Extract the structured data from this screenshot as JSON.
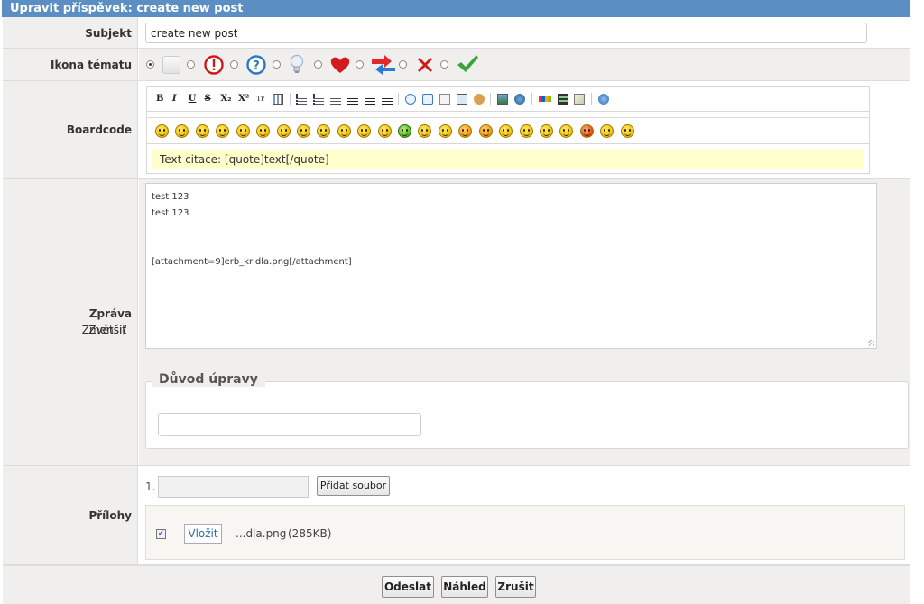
{
  "header": {
    "title": "Upravit příspěvek: create new post"
  },
  "subject": {
    "label": "Subjekt",
    "value": "create new post"
  },
  "topic_icon": {
    "label": "Ikona tématu",
    "options": [
      "none-icon",
      "blank-icon",
      "exclamation-icon",
      "question-icon",
      "lightbulb-icon",
      "heart-icon",
      "arrows-icon",
      "red-x-icon",
      "green-check-icon"
    ],
    "selected_index": 0
  },
  "boardcode": {
    "label": "Boardcode",
    "toolbar": [
      "B",
      "I",
      "U",
      "S",
      "X₂",
      "X²",
      "Tr"
    ],
    "smilies_count": 24,
    "hint": "Text citace: [quote]text[/quote]"
  },
  "message": {
    "label": "Zpráva",
    "enlarge": "Zvětšit",
    "separator": " / ",
    "shrink": "Zmenšit",
    "lines": [
      "test 123",
      "test 123",
      "",
      "",
      "[attachment=9]erb_kridla.png[/attachment]"
    ]
  },
  "edit_reason": {
    "legend": "Důvod úpravy",
    "value": ""
  },
  "attachments": {
    "label": "Přílohy",
    "index": "1.",
    "add_button": "Přidat soubor",
    "insert_button": "Vložit",
    "file_name": "...dla.png",
    "file_size": "(285KB)"
  },
  "footer": {
    "submit": "Odeslat",
    "preview": "Náhled",
    "cancel": "Zrušit"
  },
  "colors": {
    "header_bg": "#5b8fc4",
    "label_bg": "#f0efed",
    "hint_bg": "#ffffcc",
    "link": "#2b6cb0"
  }
}
